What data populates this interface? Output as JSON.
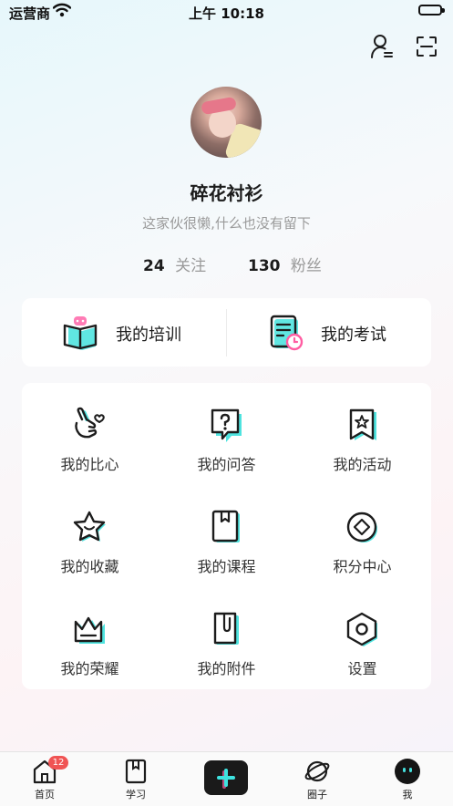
{
  "status_bar": {
    "carrier": "运营商",
    "time": "上午 10:18"
  },
  "profile": {
    "nickname": "碎花衬衫",
    "bio": "这家伙很懒,什么也没有留下",
    "following_count": "24",
    "following_label": "关注",
    "fans_count": "130",
    "fans_label": "粉丝"
  },
  "top_actions": [
    {
      "icon": "user-settings-icon"
    },
    {
      "icon": "scan-icon"
    }
  ],
  "quick_cards": [
    {
      "label": "我的培训",
      "icon": "training-book-icon"
    },
    {
      "label": "我的考试",
      "icon": "exam-clock-icon"
    }
  ],
  "menu": [
    {
      "label": "我的比心",
      "icon": "finger-heart-icon"
    },
    {
      "label": "我的问答",
      "icon": "question-icon"
    },
    {
      "label": "我的活动",
      "icon": "activity-flag-icon"
    },
    {
      "label": "我的收藏",
      "icon": "star-icon"
    },
    {
      "label": "我的课程",
      "icon": "course-book-icon"
    },
    {
      "label": "积分中心",
      "icon": "points-diamond-icon"
    },
    {
      "label": "我的荣耀",
      "icon": "crown-icon"
    },
    {
      "label": "我的附件",
      "icon": "attachment-icon"
    },
    {
      "label": "设置",
      "icon": "settings-hexagon-icon"
    }
  ],
  "tab_bar": {
    "home": {
      "label": "首页",
      "badge": "12"
    },
    "study": {
      "label": "学习"
    },
    "circle": {
      "label": "圈子"
    },
    "me": {
      "label": "我"
    }
  },
  "colors": {
    "accent_cyan": "#3ee3e0",
    "accent_pink": "#ff5da2",
    "badge_red": "#f05454"
  }
}
